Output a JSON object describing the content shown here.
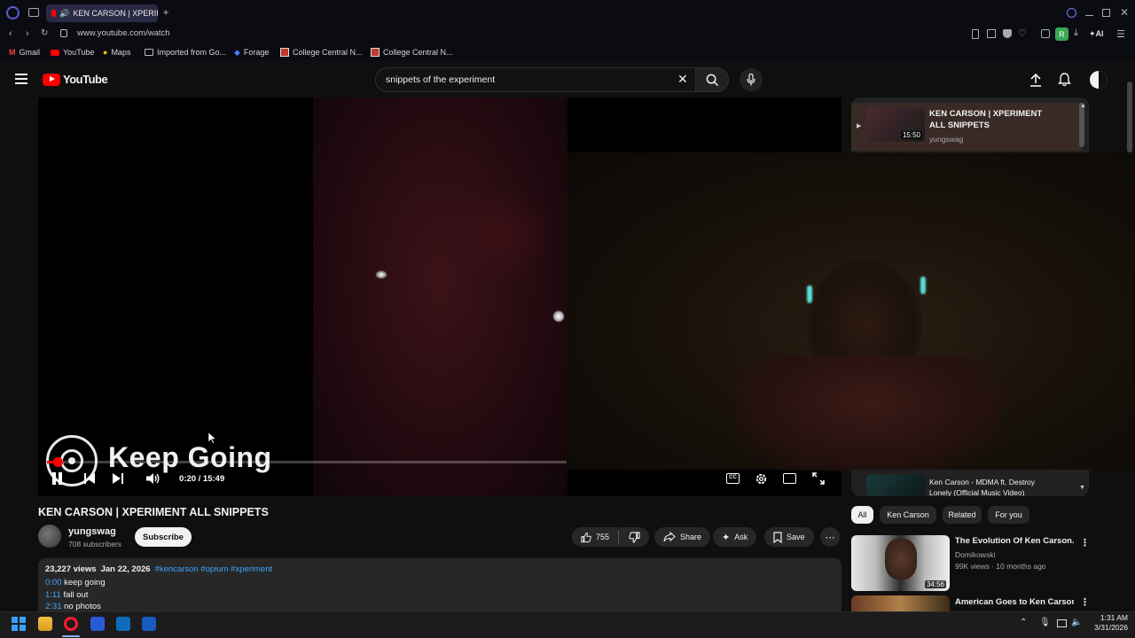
{
  "browser": {
    "tab_title": "KEN CARSON | XPERIMENT ALL SNIPPETS",
    "url": "www.youtube.com/watch",
    "ai_label": "AI",
    "profile_letter": "R",
    "bookmarks": [
      "Gmail",
      "YouTube",
      "Maps",
      "Imported from Go...",
      "Forage",
      "College Central N...",
      "College Central N..."
    ]
  },
  "youtube": {
    "logo_text": "YouTube",
    "search_value": "snippets of the experiment"
  },
  "player": {
    "overlay_title": "Keep Going",
    "time": "0:20 / 15:49",
    "progress_fraction": 0.021
  },
  "video": {
    "title": "KEN CARSON | XPERIMENT ALL SNIPPETS",
    "channel": "yungswag",
    "subscribers": "708 subscribers",
    "subscribe_label": "Subscribe",
    "likes": "755",
    "share_label": "Share",
    "ask_label": "Ask",
    "save_label": "Save",
    "views": "23,227 views",
    "date": "Jan 22, 2026",
    "hashtags": "#kencarson #opium #xperiment",
    "chapters": [
      {
        "time": "0:00",
        "label": "keep going"
      },
      {
        "time": "1:11",
        "label": "fall out"
      },
      {
        "time": "2:31",
        "label": "no photos"
      }
    ]
  },
  "playlist": {
    "now_playing_title": "KEN CARSON | XPERIMENT ALL SNIPPETS",
    "now_playing_channel": "yungswag",
    "now_playing_duration": "15:50",
    "next_title": "Ken Carson - MDMA ft. Destroy Lonely (Official Music Video)"
  },
  "chips": [
    "All",
    "Ken Carson",
    "Related",
    "For you"
  ],
  "recommendations": [
    {
      "title": "The Evolution Of Ken Carson..",
      "channel": "Domikowski",
      "meta": "99K views · 10 months ago",
      "duration": "34:56"
    },
    {
      "title": "American Goes to Ken Carson's",
      "channel": "",
      "meta": "",
      "duration": ""
    }
  ],
  "taskbar": {
    "time": "1:31 AM",
    "date": "3/31/2026"
  },
  "colors": {
    "accent_red": "#ff0000",
    "tab_bg": "#2b2a45",
    "link_blue": "#3ea6ff"
  }
}
